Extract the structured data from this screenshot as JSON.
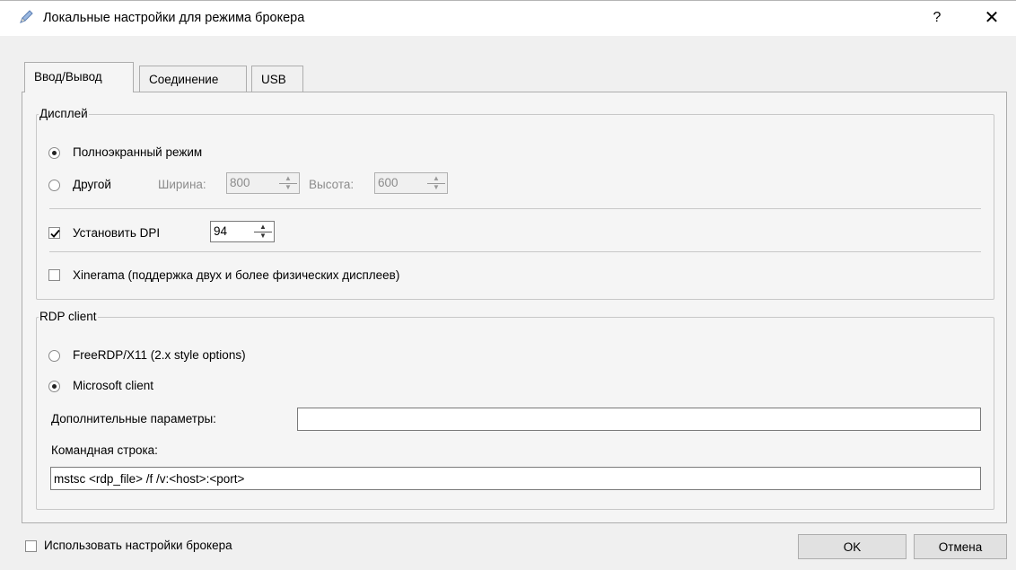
{
  "window": {
    "title": "Локальные настройки для режима брокера",
    "help_label": "?",
    "close_label": "✕"
  },
  "tabs": [
    {
      "label": "Ввод/Вывод",
      "active": true
    },
    {
      "label": "Соединение",
      "active": false
    },
    {
      "label": "USB",
      "active": false
    }
  ],
  "display": {
    "legend": "Дисплей",
    "fullscreen_label": "Полноэкранный режим",
    "fullscreen_checked": true,
    "other_label": "Другой",
    "other_checked": false,
    "width_label": "Ширина:",
    "width_value": "800",
    "height_label": "Высота:",
    "height_value": "600",
    "dpi_label": "Установить DPI",
    "dpi_checked": true,
    "dpi_value": "94",
    "xinerama_label": "Xinerama (поддержка двух и более физических дисплеев)",
    "xinerama_checked": false
  },
  "rdp": {
    "legend": "RDP client",
    "freerdp_label": "FreeRDP/X11 (2.x style options)",
    "freerdp_checked": false,
    "microsoft_label": "Microsoft client",
    "microsoft_checked": true,
    "extra_params_label": "Дополнительные параметры:",
    "extra_params_value": "",
    "cmdline_label": "Командная строка:",
    "cmdline_value": "mstsc <rdp_file> /f /v:<host>:<port>"
  },
  "footer": {
    "use_broker_label": "Использовать настройки брокера",
    "use_broker_checked": false,
    "ok_label": "OK",
    "cancel_label": "Отмена"
  }
}
